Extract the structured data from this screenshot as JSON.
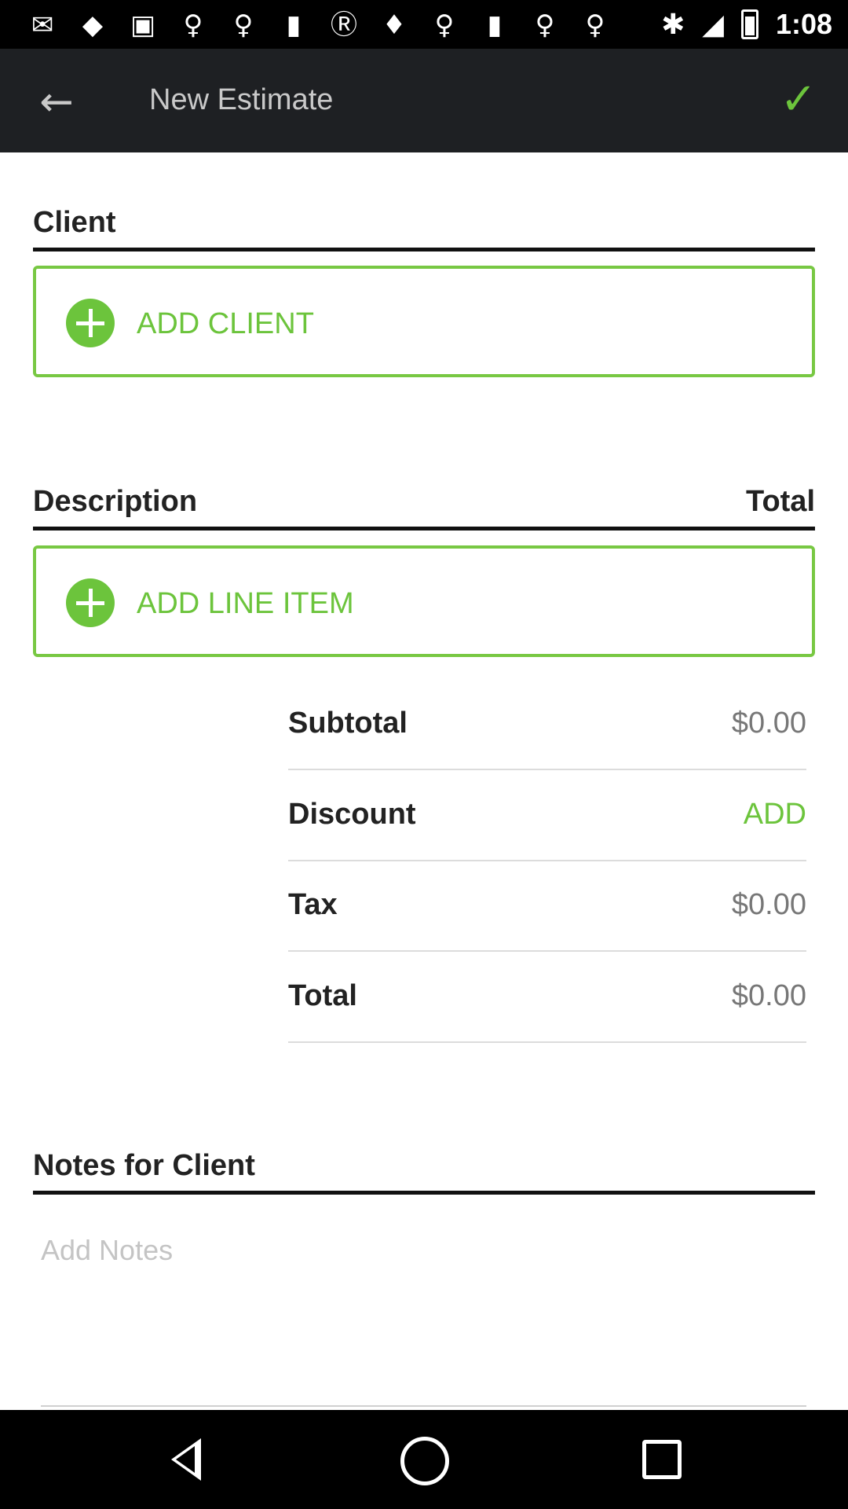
{
  "status_bar": {
    "icons": [
      "✉",
      "◆",
      "▣",
      "♀",
      "♀",
      "▮",
      "Ⓡ",
      "♦",
      "♀",
      "▮",
      "♀",
      "♀"
    ],
    "icon_names": [
      "mail-icon",
      "shield-icon",
      "app-icon",
      "location-icon",
      "location-icon",
      "square-icon",
      "r-icon",
      "bull-icon",
      "location-icon",
      "square-icon",
      "location-icon",
      "location-icon"
    ],
    "bluetooth": "✱",
    "signal": "◢",
    "time": "1:08"
  },
  "app_bar": {
    "back_icon": "←",
    "title": "New Estimate",
    "confirm_icon": "✓",
    "accent_color": "#6cc43c"
  },
  "client_section": {
    "heading": "Client",
    "add_label": "ADD CLIENT"
  },
  "line_items_section": {
    "description_header": "Description",
    "total_header": "Total",
    "add_label": "ADD LINE ITEM"
  },
  "summary": {
    "subtotal_label": "Subtotal",
    "subtotal_value": "$0.00",
    "discount_label": "Discount",
    "discount_action": "ADD",
    "tax_label": "Tax",
    "tax_value": "$0.00",
    "total_label": "Total",
    "total_value": "$0.00"
  },
  "notes_section": {
    "heading": "Notes for Client",
    "placeholder": "Add Notes",
    "value": ""
  }
}
